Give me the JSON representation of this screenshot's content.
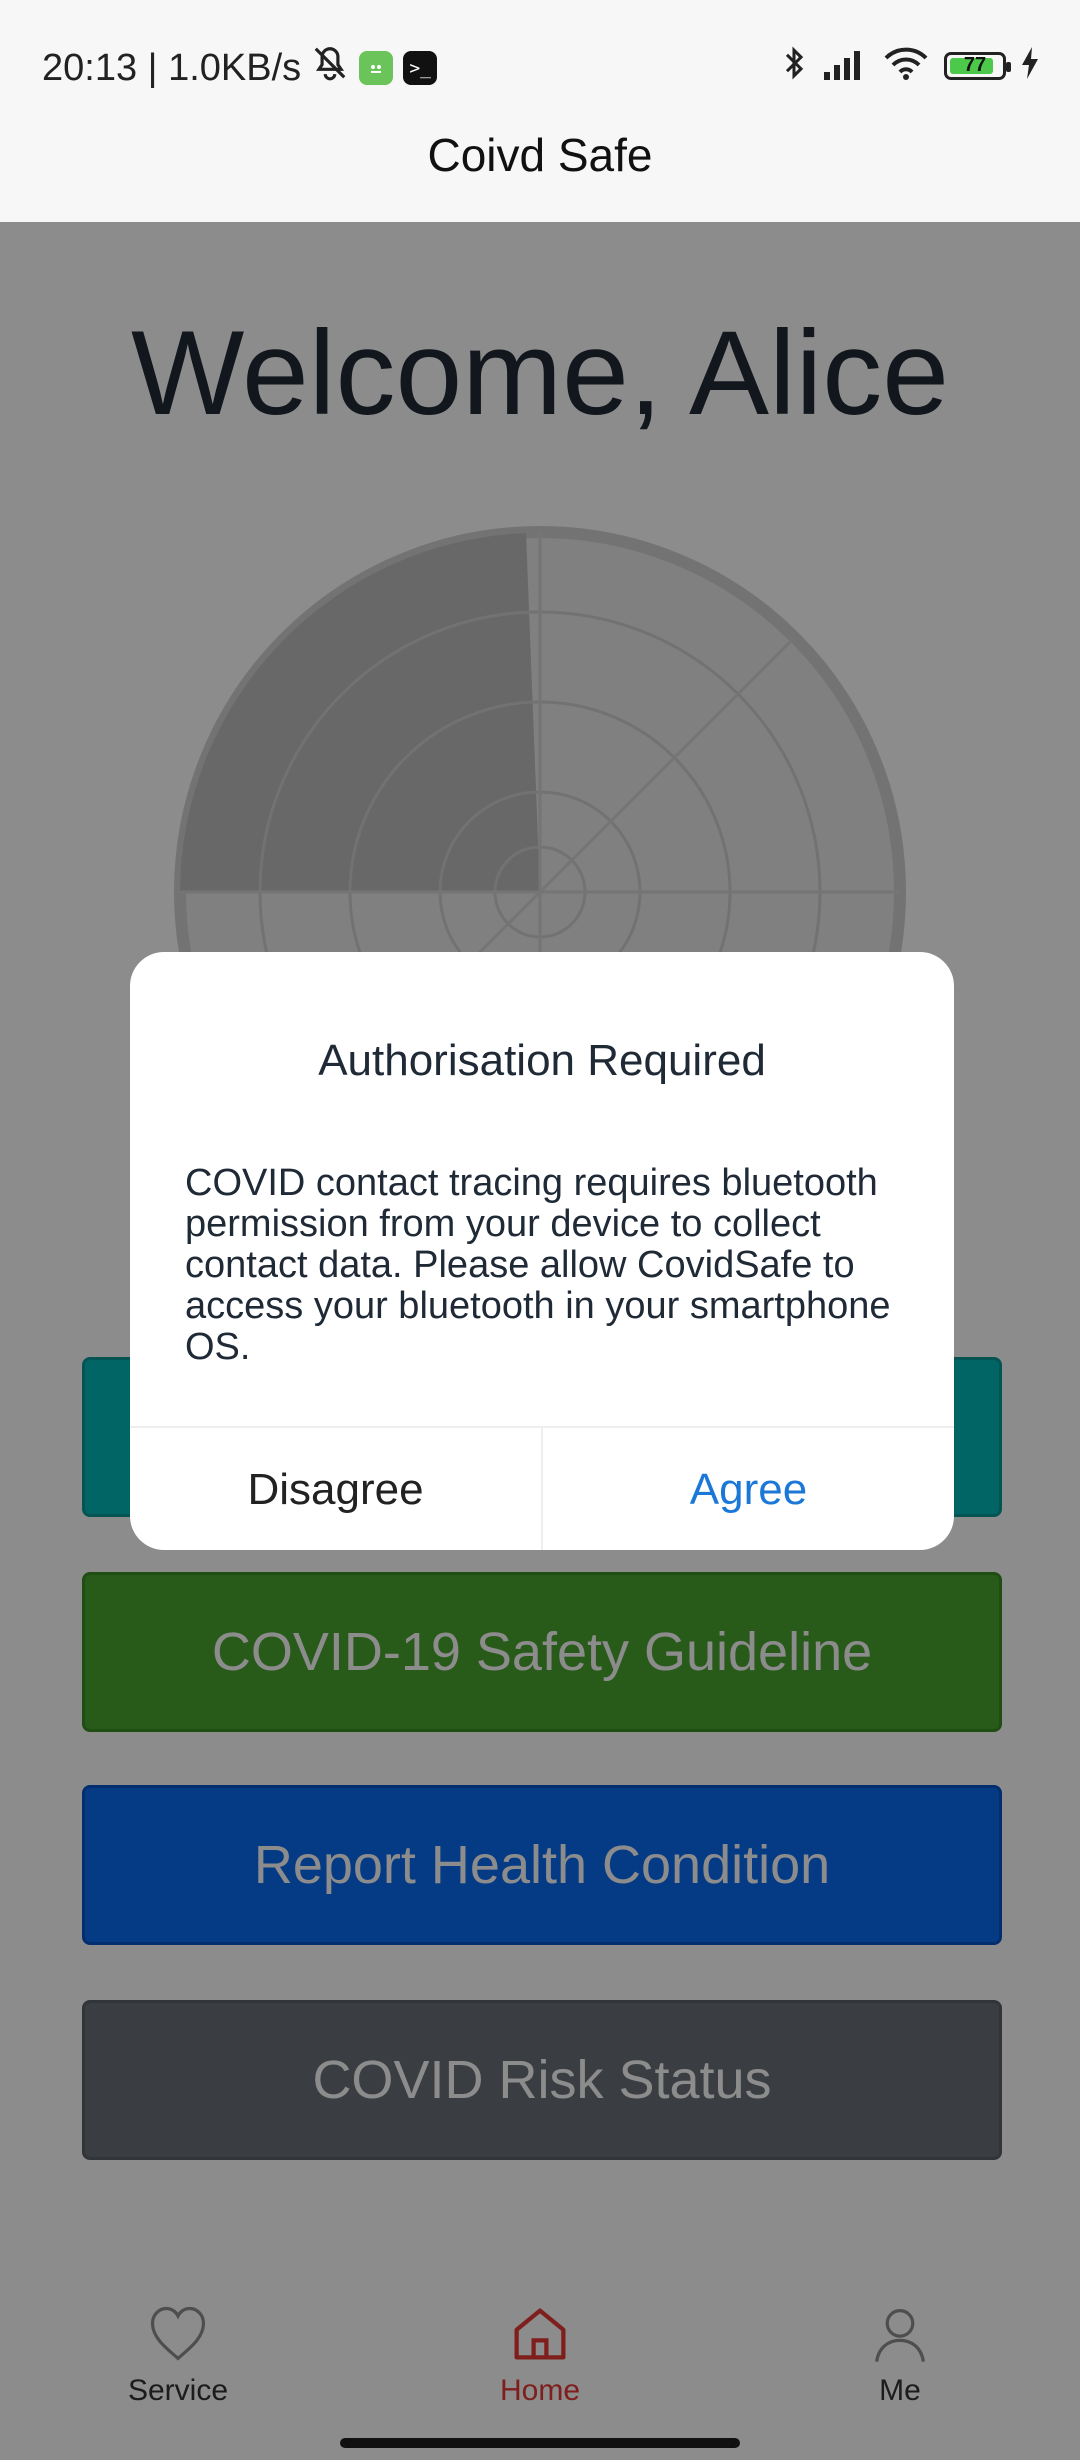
{
  "status_bar": {
    "time_and_speed": "20:13 | 1.0KB/s",
    "battery_level": "77",
    "icons": [
      "mute-icon",
      "app-icon",
      "terminal-icon",
      "bluetooth-icon",
      "signal-icon",
      "wifi-icon",
      "battery-icon",
      "charging-icon"
    ]
  },
  "app_bar": {
    "title": "Coivd Safe"
  },
  "main": {
    "welcome": "Welcome, Alice",
    "buttons": [
      {
        "label": "",
        "color": "#00b8b6"
      },
      {
        "label": "COVID-19 Safety Guideline",
        "color": "#4aa42e"
      },
      {
        "label": "Report Health Condition",
        "color": "#0a6bf0"
      },
      {
        "label": "COVID Risk Status",
        "color": "#6b717a"
      }
    ]
  },
  "dialog": {
    "title": "Authorisation Required",
    "message": "COVID contact tracing requires bluetooth permission from your device to collect contact data. Please allow CovidSafe to access your bluetooth in your smartphone OS.",
    "disagree": "Disagree",
    "agree": "Agree",
    "agree_color": "#1b78d6"
  },
  "bottom_nav": {
    "items": [
      {
        "label": "Service",
        "icon": "heart-icon"
      },
      {
        "label": "Home",
        "icon": "home-icon",
        "active": true,
        "color": "#e53935"
      },
      {
        "label": "Me",
        "icon": "user-icon"
      }
    ]
  }
}
